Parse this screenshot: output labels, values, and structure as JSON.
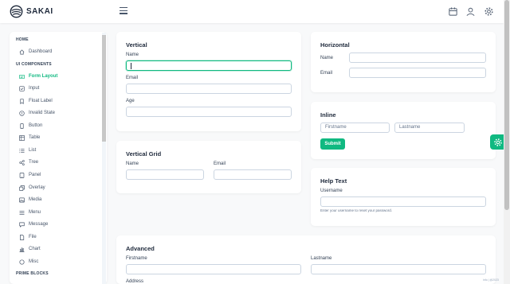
{
  "app": {
    "brand": "SAKAI"
  },
  "topbar": {
    "icons": [
      "calendar-icon",
      "user-icon",
      "cog-icon"
    ]
  },
  "sidebar": {
    "home_heading": "HOME",
    "ui_heading": "UI COMPONENTS",
    "prime_heading": "PRIME BLOCKS",
    "items": [
      {
        "label": "Dashboard",
        "icon": "home-icon"
      },
      {
        "label": "Form Layout",
        "icon": "id-card-icon",
        "active": true
      },
      {
        "label": "Input",
        "icon": "check-square-icon"
      },
      {
        "label": "Float Label",
        "icon": "bookmark-icon"
      },
      {
        "label": "Invalid State",
        "icon": "exclamation-circle-icon"
      },
      {
        "label": "Button",
        "icon": "mobile-icon"
      },
      {
        "label": "Table",
        "icon": "table-icon"
      },
      {
        "label": "List",
        "icon": "list-icon"
      },
      {
        "label": "Tree",
        "icon": "share-icon"
      },
      {
        "label": "Panel",
        "icon": "tablet-icon"
      },
      {
        "label": "Overlay",
        "icon": "clone-icon"
      },
      {
        "label": "Media",
        "icon": "image-icon"
      },
      {
        "label": "Menu",
        "icon": "bars-icon"
      },
      {
        "label": "Message",
        "icon": "comment-icon"
      },
      {
        "label": "File",
        "icon": "file-icon"
      },
      {
        "label": "Chart",
        "icon": "chart-bar-icon"
      },
      {
        "label": "Misc",
        "icon": "circle-icon"
      }
    ]
  },
  "vertical": {
    "title": "Vertical",
    "name_label": "Name",
    "email_label": "Email",
    "age_label": "Age"
  },
  "vertical_grid": {
    "title": "Vertical Grid",
    "name_label": "Name",
    "email_label": "Email"
  },
  "horizontal": {
    "title": "Horizontal",
    "name_label": "Name",
    "email_label": "Email"
  },
  "inline": {
    "title": "Inline",
    "firstname_placeholder": "Firstname",
    "lastname_placeholder": "Lastname",
    "submit_label": "Submit"
  },
  "help_text": {
    "title": "Help Text",
    "username_label": "Username",
    "hint": "Enter your username to reset your password."
  },
  "advanced": {
    "title": "Advanced",
    "firstname_label": "Firstname",
    "lastname_label": "Lastname",
    "address_label": "Address"
  },
  "footer": {
    "tag": "info | @2023"
  },
  "colors": {
    "accent": "#10b981",
    "text": "#334155"
  }
}
